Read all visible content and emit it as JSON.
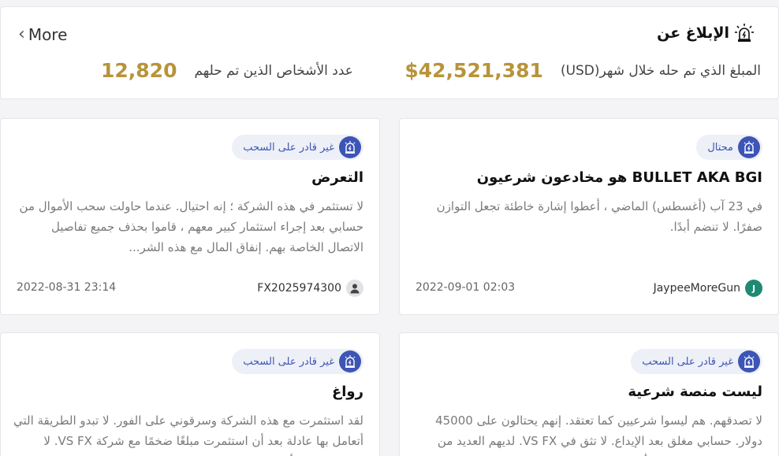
{
  "header": {
    "more_label": "More",
    "title": "الإبلاغ عن",
    "amount_label": "المبلغ الذي تم حله خلال شهر(USD)",
    "amount_value": "$42,521,381",
    "people_label": "عدد الأشخاص الذين تم حلهم",
    "people_value": "12,820"
  },
  "colors": {
    "accent_gold": "#b8933a",
    "badge_blue": "#3d55b5",
    "badge_bg": "#eef0f7"
  },
  "cards": [
    {
      "badge": "محتال",
      "title": "BULLET AKA BGI هو مخادعون شرعيون",
      "body": "في 23 آب (أغسطس) الماضي ، أعطوا إشارة خاطئة تجعل التوازن صفرًا. لا تنضم أبدًا.",
      "avatar_letter": "J",
      "user": "JaypeeMoreGun",
      "date": "2022-09-01 02:03"
    },
    {
      "badge": "غير قادر على السحب",
      "title": "التعرض",
      "body": "لا تستثمر في هذه الشركة ؛ إنه احتيال. عندما حاولت سحب الأموال من حسابي بعد إجراء استثمار كبير معهم ، قاموا بحذف جميع تفاصيل الاتصال الخاصة بهم. إنفاق المال مع هذه الشر...",
      "user": "FX2025974300",
      "date": "2022-08-31 23:14"
    },
    {
      "badge": "غير قادر على السحب",
      "title": "ليست منصة شرعية",
      "body": "لا تصدقهم. هم ليسوا شرعيين كما تعتقد. إنهم يحتالون على 45000 دولار. حسابي مغلق بعد الإيداع. لا تثق في VS FX. لديهم العديد من الشكاوى عبر الإنترنت وأنشطة احتيالية."
    },
    {
      "badge": "غير قادر على السحب",
      "title": "رواغ",
      "body": "لقد استثمرت مع هذه الشركة وسرقوني على الفور. لا تبدو الطريقة التي أتعامل بها عادلة بعد أن استثمرت مبلغًا ضخمًا مع شركة VS FX. لا يمكنني سحب أموالي."
    }
  ]
}
